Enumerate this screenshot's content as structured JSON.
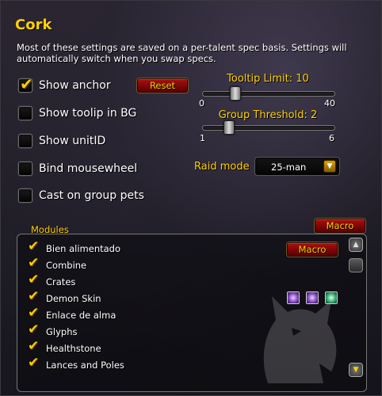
{
  "title": "Cork",
  "description": "Most of these settings are saved on a per-talent spec basis.  Settings will automatically switch when you swap specs.",
  "checkboxes": [
    {
      "label": "Show anchor",
      "checked": true
    },
    {
      "label": "Show toolip in BG",
      "checked": false
    },
    {
      "label": "Show unitID",
      "checked": false
    },
    {
      "label": "Bind mousewheel",
      "checked": false
    },
    {
      "label": "Cast on group pets",
      "checked": false
    }
  ],
  "reset_label": "Reset",
  "tooltip_slider": {
    "label": "Tooltip Limit: 10",
    "min": "0",
    "max": "40",
    "value": 10,
    "range": [
      0,
      40
    ]
  },
  "group_slider": {
    "label": "Group Threshold: 2",
    "min": "1",
    "max": "6",
    "value": 2,
    "range": [
      1,
      6
    ]
  },
  "raid_mode": {
    "label": "Raid mode",
    "value": "25-man",
    "arrow_icon": "dropdown-arrow-icon"
  },
  "modules_label": "Modules",
  "macro_label": "Macro",
  "modules": [
    {
      "label": "Bien alimentado",
      "checked": true
    },
    {
      "label": "Combine",
      "checked": true
    },
    {
      "label": "Crates",
      "checked": true
    },
    {
      "label": "Demon Skin",
      "checked": true
    },
    {
      "label": "Enlace de alma",
      "checked": true
    },
    {
      "label": "Glyphs",
      "checked": true
    },
    {
      "label": "Healthstone",
      "checked": true
    },
    {
      "label": "Lances and Poles",
      "checked": true
    }
  ],
  "module_macro_label": "Macro",
  "demon_skin_icons": [
    "purple-buff-icon",
    "purple-buff-icon",
    "green-buff-icon"
  ],
  "colors": {
    "accent": "#ffd100",
    "button": "#a81010",
    "checkmark": "#ffcc00"
  }
}
